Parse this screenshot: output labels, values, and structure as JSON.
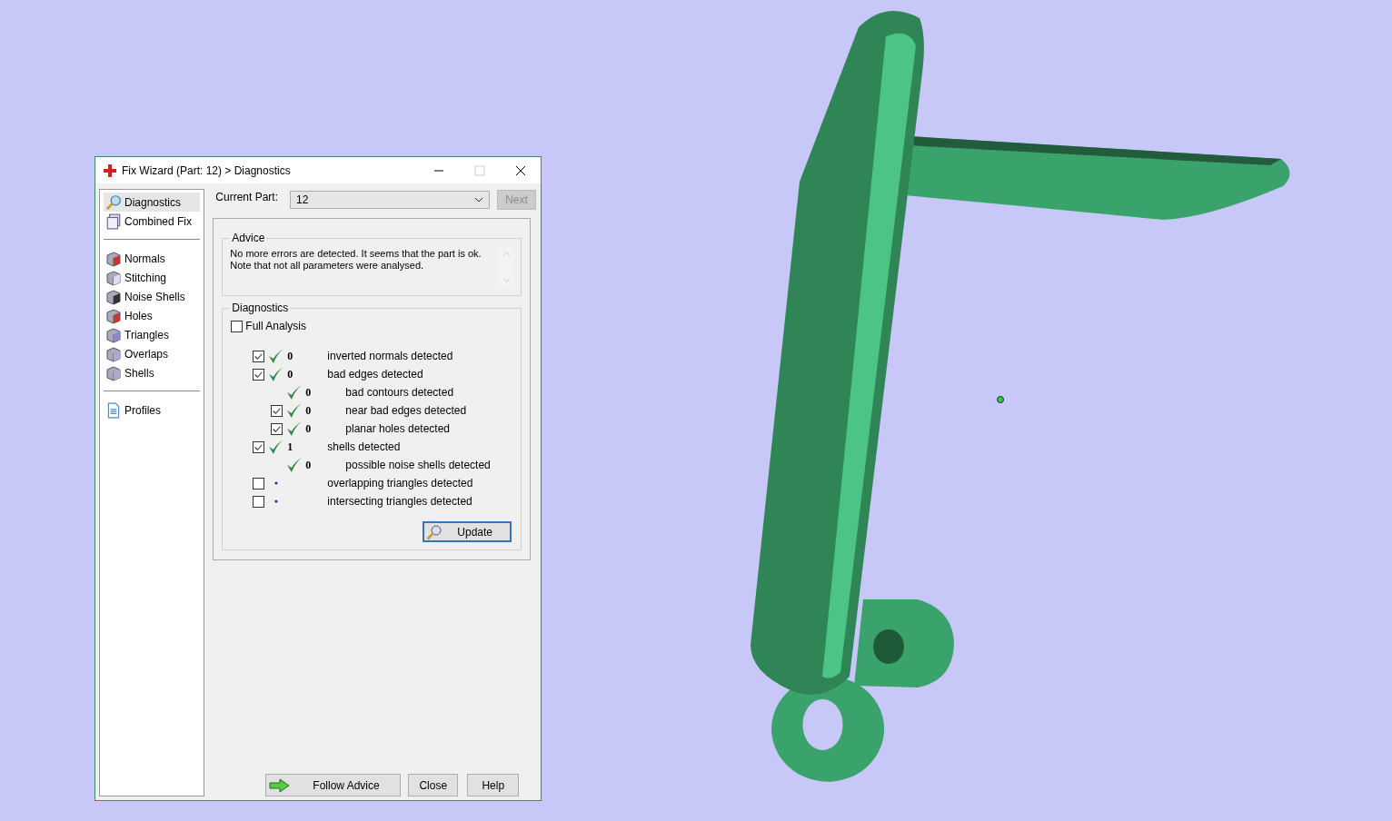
{
  "window": {
    "title": "Fix Wizard (Part: 12) > Diagnostics"
  },
  "sidebar": {
    "groups": [
      [
        {
          "label": "Diagnostics",
          "selected": true
        },
        {
          "label": "Combined Fix",
          "selected": false
        }
      ],
      [
        {
          "label": "Normals",
          "selected": false
        },
        {
          "label": "Stitching",
          "selected": false
        },
        {
          "label": "Noise Shells",
          "selected": false
        },
        {
          "label": "Holes",
          "selected": false
        },
        {
          "label": "Triangles",
          "selected": false
        },
        {
          "label": "Overlaps",
          "selected": false
        },
        {
          "label": "Shells",
          "selected": false
        }
      ],
      [
        {
          "label": "Profiles",
          "selected": false
        }
      ]
    ]
  },
  "current_part": {
    "label": "Current Part:",
    "value": "12",
    "next_button": {
      "label": "Next",
      "disabled": true
    }
  },
  "advice": {
    "title": "Advice",
    "text": "No more errors are detected. It seems that the part is ok.\nNote that not all parameters were analysed."
  },
  "diagnostics": {
    "title": "Diagnostics",
    "full_analysis": {
      "label": "Full Analysis",
      "checked": false
    },
    "rows": [
      {
        "kind": "toggle",
        "checked": true,
        "passed": true,
        "count": "0",
        "label": "inverted normals detected"
      },
      {
        "kind": "toggle",
        "checked": true,
        "passed": true,
        "count": "0",
        "label": "bad edges detected",
        "children": [
          {
            "kind": "fixed",
            "passed": true,
            "count": "0",
            "label": "bad contours detected"
          },
          {
            "kind": "toggle",
            "checked": true,
            "passed": true,
            "count": "0",
            "label": "near bad edges detected"
          },
          {
            "kind": "toggle",
            "checked": true,
            "passed": true,
            "count": "0",
            "label": "planar holes detected"
          }
        ]
      },
      {
        "kind": "toggle",
        "checked": true,
        "passed": true,
        "count": "1",
        "label": "shells detected",
        "children": [
          {
            "kind": "fixed",
            "passed": true,
            "count": "0",
            "label": "possible noise shells detected"
          }
        ]
      },
      {
        "kind": "toggle",
        "checked": false,
        "passed": false,
        "label": "overlapping triangles detected"
      },
      {
        "kind": "toggle",
        "checked": false,
        "passed": false,
        "label": "intersecting triangles detected"
      }
    ],
    "update_button": "Update"
  },
  "buttons": [
    "Follow Advice",
    "Close",
    "Help"
  ]
}
